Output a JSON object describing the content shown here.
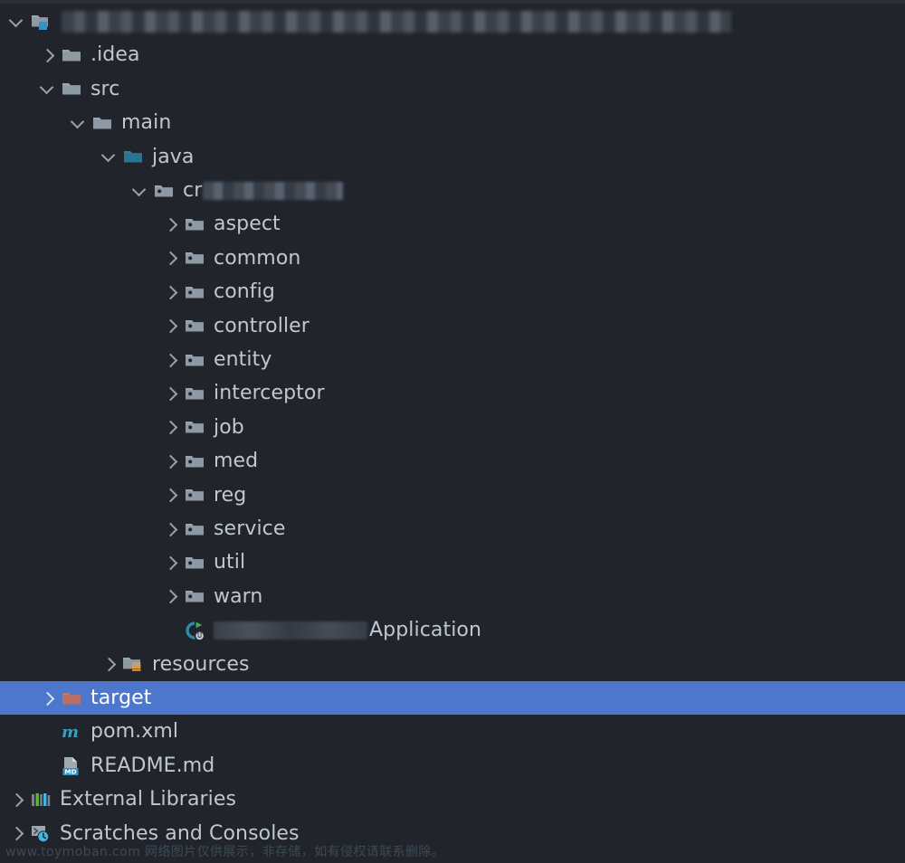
{
  "window": {
    "title": "Project tool window",
    "theme_background": "#21242b",
    "selection_color": "#4d77cc",
    "text_color": "#bfc7d1"
  },
  "tree": {
    "rows": [
      {
        "label": "",
        "redacted": true,
        "redacted_width": 740,
        "icon": "module-folder-icon",
        "chevron": "down",
        "indent": 0,
        "name": "tree-item-project-root"
      },
      {
        "label": ".idea",
        "icon": "folder-icon",
        "chevron": "right",
        "indent": 1,
        "name": "tree-item-idea"
      },
      {
        "label": "src",
        "icon": "folder-icon",
        "chevron": "down",
        "indent": 1,
        "name": "tree-item-src"
      },
      {
        "label": "main",
        "icon": "folder-icon",
        "chevron": "down",
        "indent": 2,
        "name": "tree-item-main"
      },
      {
        "label": "java",
        "icon": "sources-root-icon",
        "chevron": "down",
        "indent": 3,
        "name": "tree-item-java"
      },
      {
        "label": "cr",
        "icon": "package-icon",
        "chevron": "down",
        "indent": 4,
        "name": "tree-item-base-package",
        "redacted_tail": 155
      },
      {
        "label": "aspect",
        "icon": "package-icon",
        "chevron": "right",
        "indent": 5,
        "name": "tree-item-aspect"
      },
      {
        "label": "common",
        "icon": "package-icon",
        "chevron": "right",
        "indent": 5,
        "name": "tree-item-common"
      },
      {
        "label": "config",
        "icon": "package-icon",
        "chevron": "right",
        "indent": 5,
        "name": "tree-item-config"
      },
      {
        "label": "controller",
        "icon": "package-icon",
        "chevron": "right",
        "indent": 5,
        "name": "tree-item-controller"
      },
      {
        "label": "entity",
        "icon": "package-icon",
        "chevron": "right",
        "indent": 5,
        "name": "tree-item-entity"
      },
      {
        "label": "interceptor",
        "icon": "package-icon",
        "chevron": "right",
        "indent": 5,
        "name": "tree-item-interceptor"
      },
      {
        "label": "job",
        "icon": "package-icon",
        "chevron": "right",
        "indent": 5,
        "name": "tree-item-job"
      },
      {
        "label": "med",
        "icon": "package-icon",
        "chevron": "right",
        "indent": 5,
        "name": "tree-item-med"
      },
      {
        "label": "reg",
        "icon": "package-icon",
        "chevron": "right",
        "indent": 5,
        "name": "tree-item-reg"
      },
      {
        "label": "service",
        "icon": "package-icon",
        "chevron": "right",
        "indent": 5,
        "name": "tree-item-service"
      },
      {
        "label": "util",
        "icon": "package-icon",
        "chevron": "right",
        "indent": 5,
        "name": "tree-item-util"
      },
      {
        "label": "warn",
        "icon": "package-icon",
        "chevron": "right",
        "indent": 5,
        "name": "tree-item-warn"
      },
      {
        "label": "Application",
        "icon": "spring-boot-run-icon",
        "chevron": "none",
        "indent": 5,
        "name": "tree-item-application-class",
        "redacted_head": 170
      },
      {
        "label": "resources",
        "icon": "resources-root-icon",
        "chevron": "right",
        "indent": 3,
        "name": "tree-item-resources"
      },
      {
        "label": "target",
        "icon": "excluded-folder-icon",
        "chevron": "right",
        "indent": 1,
        "name": "tree-item-target",
        "selected": true
      },
      {
        "label": "pom.xml",
        "icon": "maven-file-icon",
        "chevron": "none",
        "indent": 1,
        "name": "tree-item-pom-xml"
      },
      {
        "label": "README.md",
        "icon": "markdown-file-icon",
        "chevron": "none",
        "indent": 1,
        "name": "tree-item-readme-md"
      },
      {
        "label": "External Libraries",
        "icon": "external-libraries-icon",
        "chevron": "right",
        "indent": 0,
        "name": "tree-item-external-libraries"
      },
      {
        "label": "Scratches and Consoles",
        "icon": "scratches-icon",
        "chevron": "right",
        "indent": 0,
        "name": "tree-item-scratches-and-consoles"
      }
    ]
  },
  "watermark": {
    "text": "www.toymoban.com 网络图片仅供展示，非存储，如有侵权请联系删除。"
  }
}
